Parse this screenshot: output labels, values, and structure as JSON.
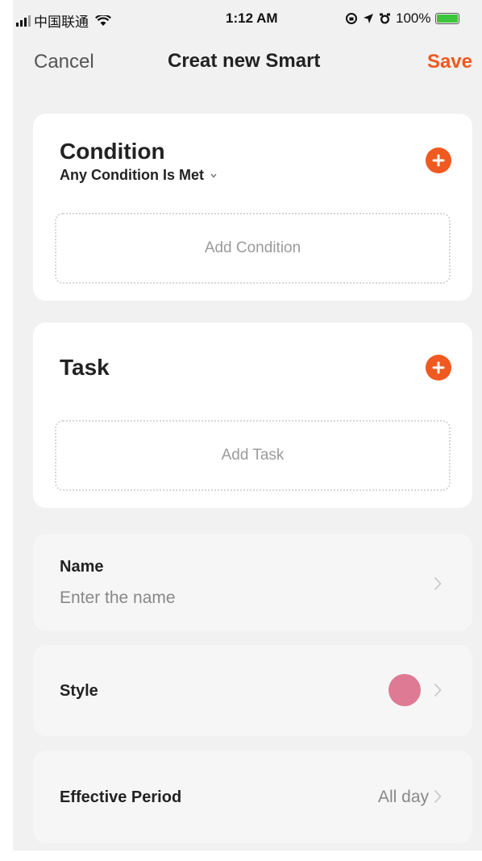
{
  "status": {
    "carrier": "中国联通",
    "time": "1:12 AM",
    "battery": "100%",
    "battery_level": 1.0,
    "battery_color": "#3dc43d"
  },
  "nav": {
    "cancel_label": "Cancel",
    "title": "Creat new Smart",
    "save_label": "Save",
    "accent_color": "#f0591f"
  },
  "condition": {
    "title": "Condition",
    "mode": "Any Condition Is Met",
    "add_label": "Add Condition"
  },
  "task": {
    "title": "Task",
    "add_label": "Add Task"
  },
  "name_row": {
    "label": "Name",
    "placeholder": "Enter the name"
  },
  "style_row": {
    "label": "Style",
    "color": "#de7a93"
  },
  "period_row": {
    "label": "Effective Period",
    "value": "All day"
  }
}
